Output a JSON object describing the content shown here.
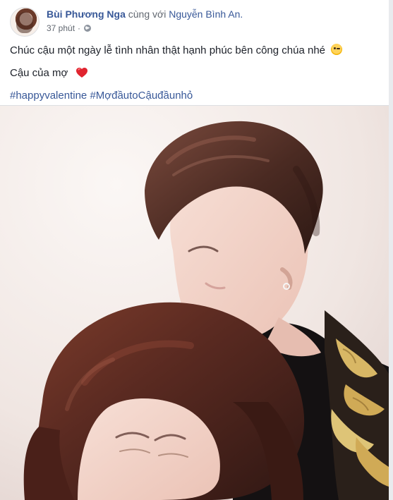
{
  "post": {
    "author": "Bùi Phương Nga",
    "with_text": "cùng với",
    "tagged": "Nguyễn Bình An.",
    "time": "37 phút",
    "dot": "·",
    "privacy_icon": "globe-icon",
    "text_line_1": "Chúc cậu một ngày lễ tình nhân thật hạnh phúc bên công chúa nhé",
    "text_line_2": "Cậu của mợ",
    "hashtags": [
      "#happyvalentine",
      "#MợđầutoCậuđầunhỏ"
    ],
    "emoji_1": "wink-emoji",
    "emoji_2": "heart-emoji"
  },
  "colors": {
    "link": "#385898",
    "text": "#1d2129",
    "secondary": "#616770",
    "heart": "#e0242f"
  }
}
